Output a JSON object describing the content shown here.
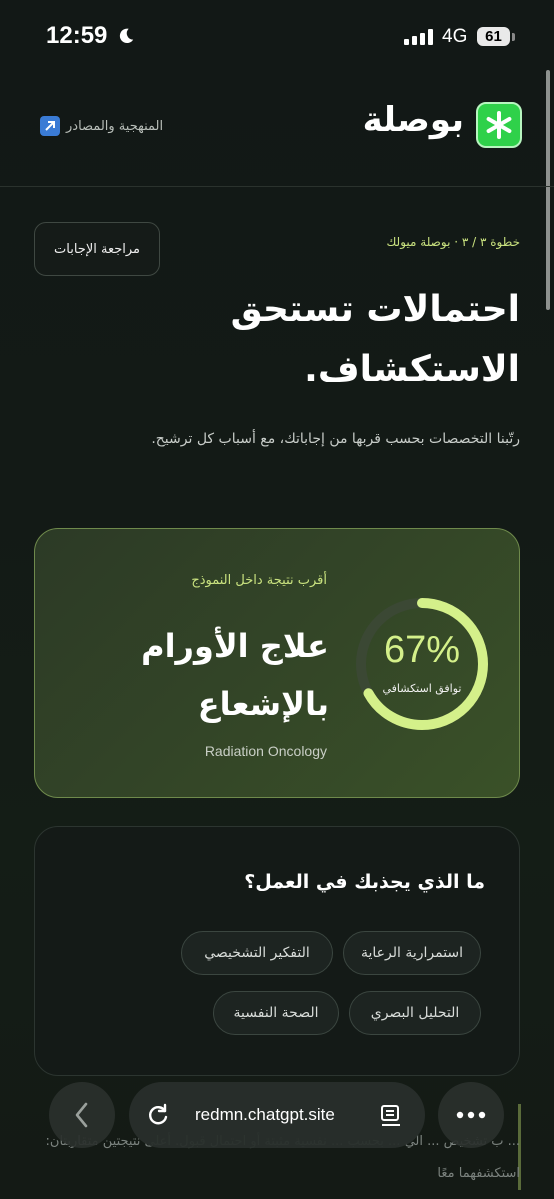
{
  "status_bar": {
    "time": "12:59",
    "network": "4G",
    "battery": "61"
  },
  "header": {
    "brand": "بوصلة",
    "method_link": "المنهجية والمصادر"
  },
  "hero": {
    "review_button": "مراجعة الإجابات",
    "step": "خطوة ٣ / ٣ · بوصلة ميولك",
    "title": "احتمالات تستحق الاستكشاف.",
    "description": "رتّبنا التخصصات بحسب قربها من إجاباتك، مع أسباب كل ترشيح."
  },
  "result": {
    "kicker": "أقرب نتيجة داخل النموذج",
    "title": "علاج الأورام بالإشعاع",
    "english": "Radiation Oncology",
    "percent_text": "67%",
    "percent_value": 0.67,
    "percent_label": "توافق استكشافي",
    "accent": "#d4f08a"
  },
  "attraction": {
    "title": "ما الذي يجذبك في العمل؟",
    "chips": [
      "استمرارية الرعاية",
      "التفكير التشخيصي",
      "التحليل البصري",
      "الصحة النفسية"
    ]
  },
  "background_text": "... ب تشخيص ... الي ... بحسب ... نفسية مثبتة أو احتمال قبول. أعلى نتيجتين متقاربتان: استكشفهما معًا",
  "browser": {
    "url": "redmn.chatgpt.site"
  },
  "icons": [
    "moon-icon",
    "signal-icon",
    "asterisk-icon",
    "external-link-icon",
    "chevron-left-icon",
    "reload-icon",
    "reader-icon",
    "more-icon"
  ]
}
